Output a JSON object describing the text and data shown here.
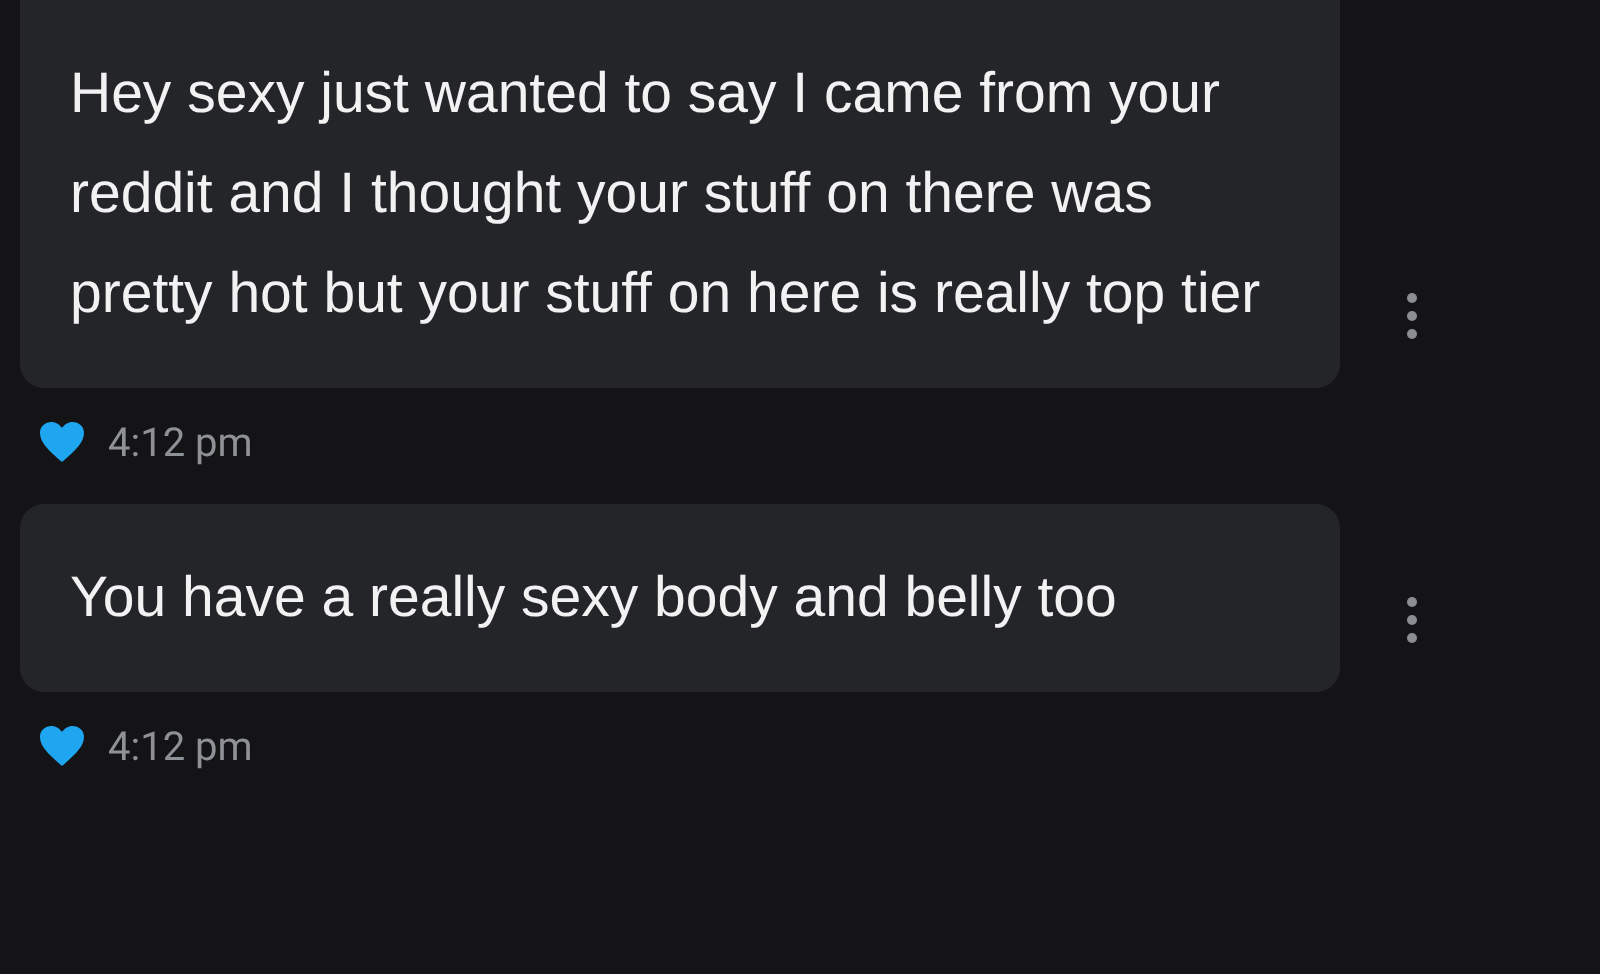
{
  "messages": [
    {
      "text": "Hey sexy just wanted to say I came from your reddit and I thought your stuff on there was pretty hot but your stuff on here is really top tier",
      "time": "4:12 pm",
      "liked": true
    },
    {
      "text": "You have a really sexy body and belly too",
      "time": "4:12 pm",
      "liked": true
    }
  ]
}
